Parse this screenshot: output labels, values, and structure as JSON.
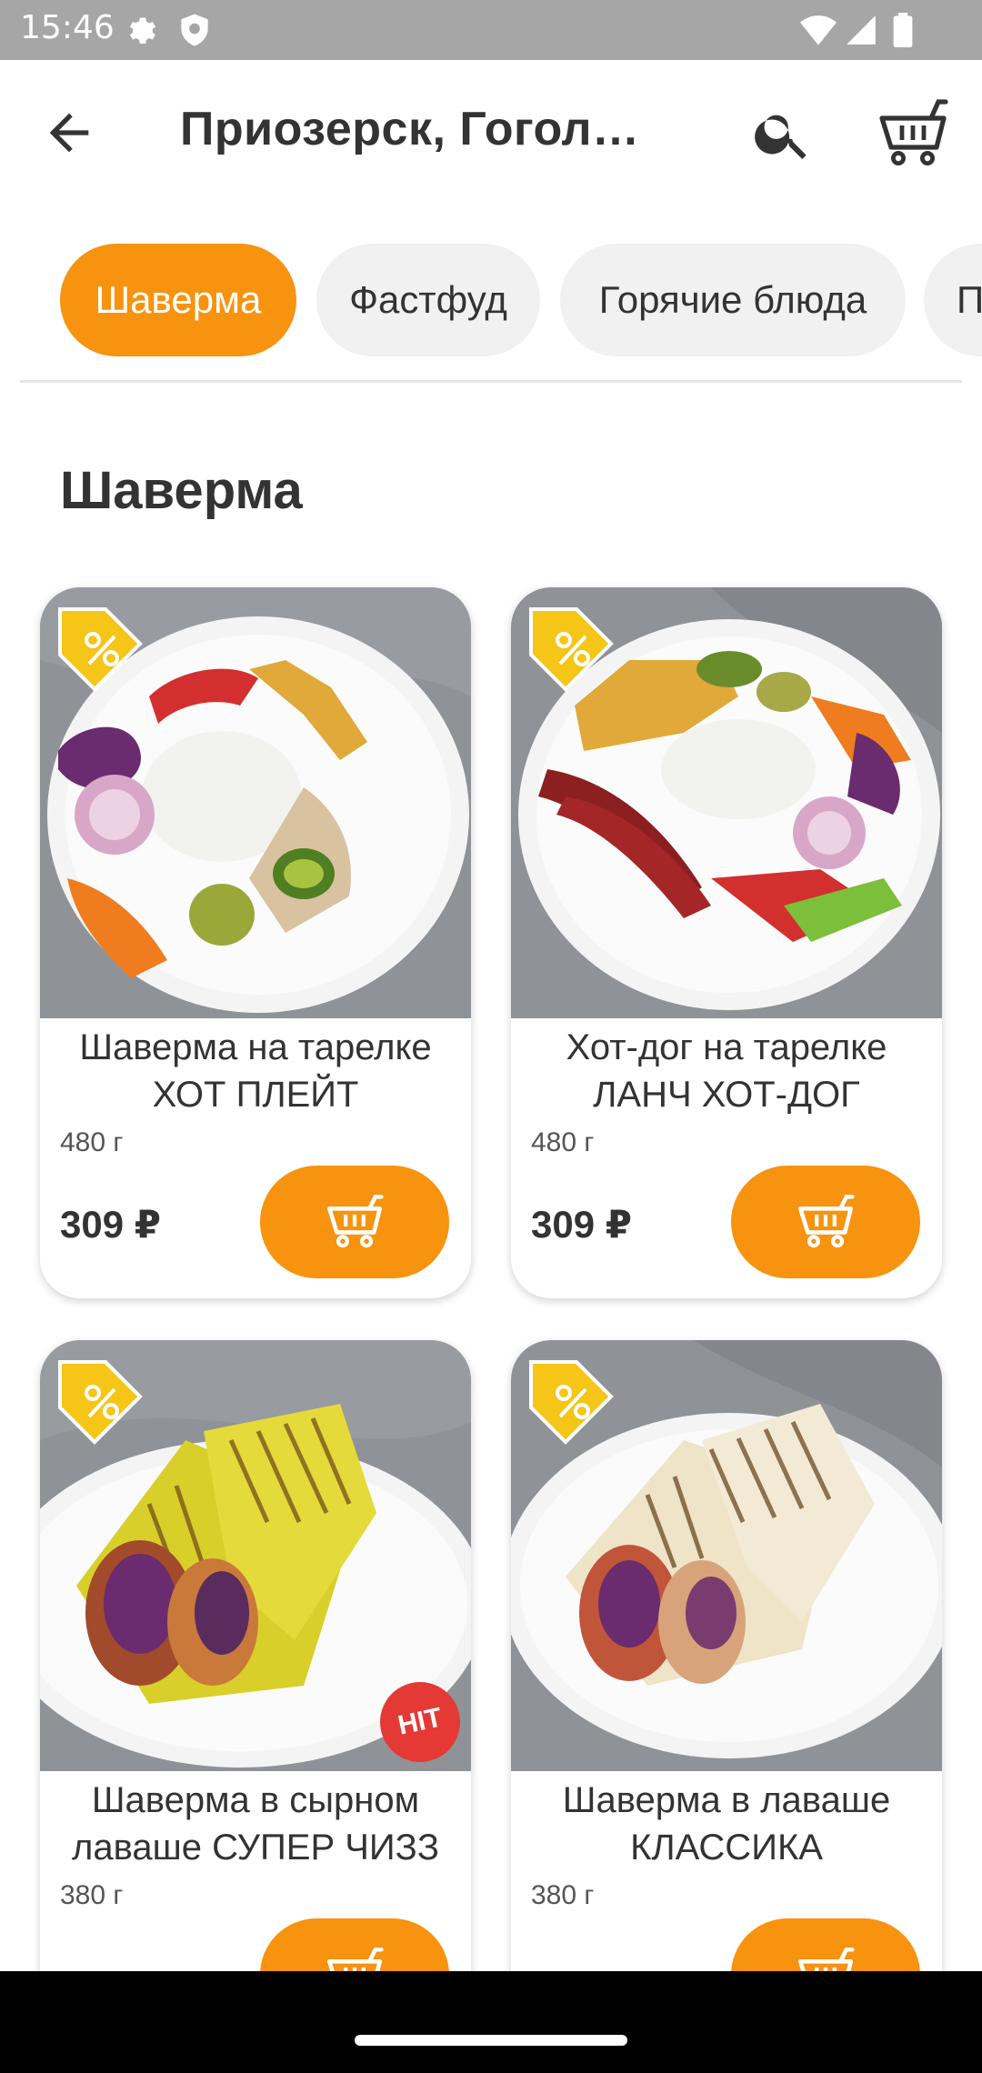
{
  "status_bar": {
    "time": "15:46",
    "icons": [
      "gear-icon",
      "shield-icon",
      "wifi-icon",
      "signal-icon",
      "battery-icon"
    ]
  },
  "app_bar": {
    "title": "Приозерск, Гогол…",
    "icons": [
      "arrow-back-icon",
      "search-icon",
      "cart-icon"
    ]
  },
  "category_tabs": [
    {
      "label": "Шаверма",
      "active": true
    },
    {
      "label": "Фастфуд",
      "active": false
    },
    {
      "label": "Горячие блюда",
      "active": false
    },
    {
      "label": "П",
      "active": false
    }
  ],
  "section_title": "Шаверма",
  "products": [
    {
      "name": "Шаверма на тарелке ХОТ ПЛЕЙТ",
      "weight": "480 г",
      "price": "309 ₽",
      "discount": true,
      "hit": false
    },
    {
      "name": "Хот-дог на тарелке ЛАНЧ ХОТ-ДОГ",
      "weight": "480 г",
      "price": "309 ₽",
      "discount": true,
      "hit": false
    },
    {
      "name": "Шаверма в сырном лаваше СУПЕР ЧИЗЗ",
      "weight": "380 г",
      "price": "",
      "discount": true,
      "hit": true,
      "hit_label": "HIT"
    },
    {
      "name": "Шаверма в лаваше КЛАССИКА",
      "weight": "380 г",
      "price": "",
      "discount": true,
      "hit": false
    }
  ],
  "colors": {
    "accent": "#f7930e",
    "hit": "#e53935",
    "tag": "#f5c518"
  }
}
